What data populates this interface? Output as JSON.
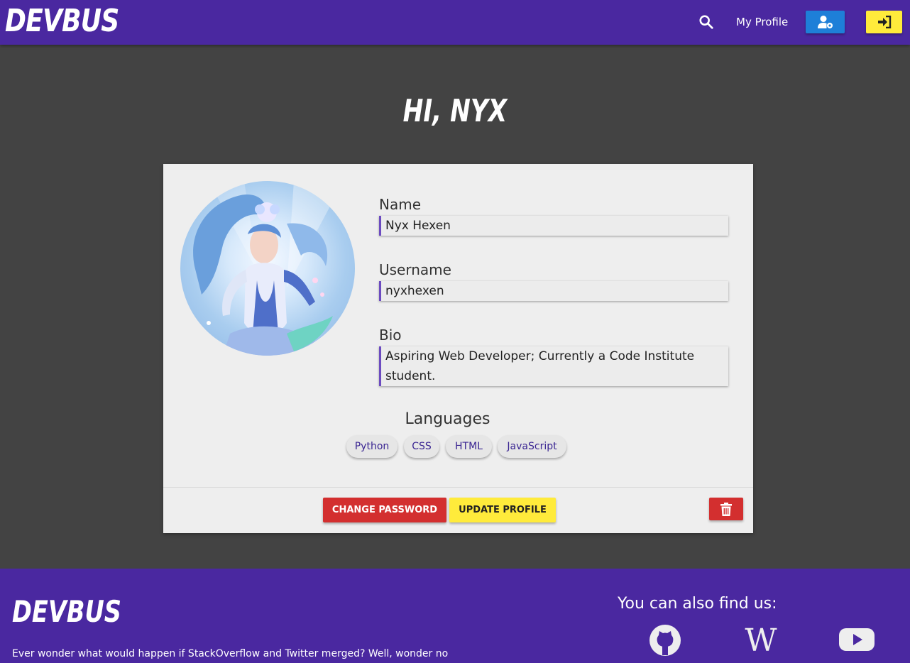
{
  "navbar": {
    "brand": "DEVBUS",
    "search_icon": "search-icon",
    "profile_link": "My Profile",
    "settings_icon": "user-cog-icon",
    "login_icon": "sign-in-icon",
    "color": "#4a28a0"
  },
  "page": {
    "heading": "HI, NYX"
  },
  "profile": {
    "avatar": "profile-avatar-image",
    "name_label": "Name",
    "name_value": "Nyx Hexen",
    "username_label": "Username",
    "username_value": "nyxhexen",
    "bio_label": "Bio",
    "bio_value": "Aspiring Web Developer; Currently a Code Institute student.",
    "languages_title": "Languages",
    "languages": [
      "Python",
      "CSS",
      "HTML",
      "JavaScript"
    ]
  },
  "actions": {
    "change_password": "Change Password",
    "update_profile": "Update Profile",
    "delete_icon": "trash-icon"
  },
  "footer": {
    "brand": "DEVBUS",
    "tagline": "Ever wonder what would happen if StackOverflow and Twitter merged? Well, wonder no",
    "find_us": "You can also find us:",
    "social": [
      "github-icon",
      "wikipedia-icon",
      "youtube-icon"
    ]
  },
  "colors": {
    "background": "#434343",
    "accent_blue": "#1e7fd8",
    "accent_yellow": "#ffeb3b",
    "danger_red": "#d32f2f",
    "card": "#eeeeee"
  }
}
